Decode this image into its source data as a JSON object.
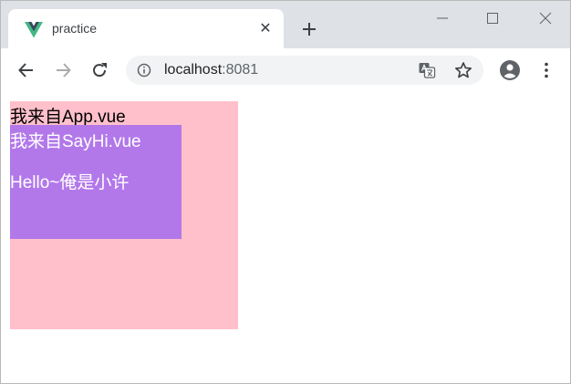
{
  "tab": {
    "title": "practice",
    "favicon_icon": "vue-logo-icon",
    "close_glyph": "✕"
  },
  "toolbar": {
    "back_icon": "arrow-left-icon",
    "forward_icon": "arrow-right-icon",
    "reload_icon": "reload-icon",
    "url_host": "localhost",
    "url_port": ":8081",
    "translate_icon": "translate-icon",
    "bookmark_icon": "star-icon",
    "account_icon": "account-circle-icon",
    "menu_icon": "kebab-menu-icon"
  },
  "colors": {
    "tab_strip": "#dee1e6",
    "app_background": "#ffc0cb",
    "sayhi_background": "#b278ea",
    "vue_green": "#41b883",
    "vue_dark": "#35495e"
  },
  "page": {
    "app_text": "我来自App.vue",
    "sayhi_title": "我来自SayHi.vue",
    "sayhi_message": "Hello~俺是小许"
  }
}
